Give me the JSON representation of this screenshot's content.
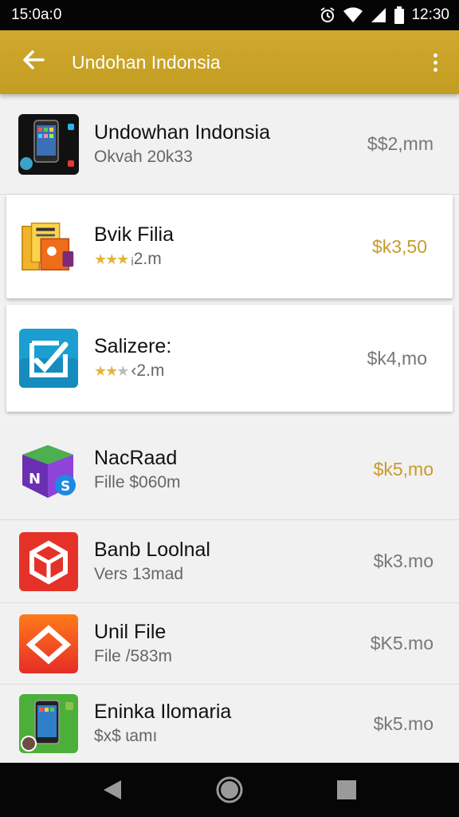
{
  "status_bar": {
    "time_left": "15:0a:0",
    "time_right": "12:30",
    "icons": [
      "alarm-icon",
      "wifi-icon",
      "signal-icon",
      "battery-icon"
    ]
  },
  "app_bar": {
    "title": "Undohan Indonsia",
    "color": "#c9a227"
  },
  "items": [
    {
      "title": "Undowhan Indonsia",
      "subtitle": "Okvah 20k33",
      "price": "$$2,mm",
      "price_color": "#777777",
      "style": "flat",
      "icon": "phone-app-icon"
    },
    {
      "title": "Bvik Filia",
      "subtitle": "ᵢ2.m",
      "rating": 3,
      "price": "$k3,50",
      "price_color": "#c89b2b",
      "style": "card",
      "icon": "books-app-icon"
    },
    {
      "title": "Salizere:",
      "subtitle": "‹2.m",
      "rating": 2,
      "price": "$k4,mo",
      "price_color": "#777777",
      "style": "card",
      "icon": "edit-check-icon"
    },
    {
      "title": "NacRaad",
      "subtitle": "Fille $060m",
      "price": "$k5,mo",
      "price_color": "#c89b2b",
      "style": "flat",
      "icon": "purple-book-icon"
    },
    {
      "title": "Banb Loolnal",
      "subtitle": "Vers 13mad",
      "price": "$k3.mo",
      "price_color": "#777777",
      "style": "flat",
      "icon": "red-cube-icon"
    },
    {
      "title": "Unil File",
      "subtitle": "File  /583m",
      "price": "$K5.mo",
      "price_color": "#777777",
      "style": "flat",
      "icon": "diamond-app-icon"
    },
    {
      "title": "Eninka Ilomaria",
      "subtitle": "$x$ ɩamı",
      "price": "$k5.mo",
      "price_color": "#777777",
      "style": "flat",
      "icon": "green-phone-icon"
    }
  ],
  "nav_bar": {
    "icons": [
      "back-nav-icon",
      "home-nav-icon",
      "recents-nav-icon"
    ]
  }
}
